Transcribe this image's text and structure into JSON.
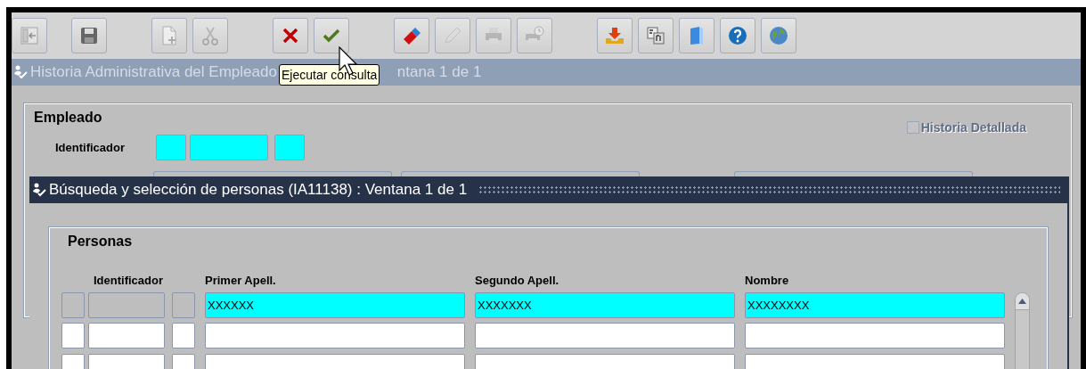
{
  "toolbar": {
    "groups": [
      [
        {
          "kind": "exit",
          "disabled": true
        }
      ],
      [
        {
          "kind": "save",
          "disabled": false
        }
      ],
      [
        {
          "kind": "new",
          "disabled": true
        },
        {
          "kind": "cut",
          "disabled": true
        }
      ],
      [
        {
          "kind": "cancel",
          "disabled": false
        },
        {
          "kind": "accept",
          "disabled": false
        }
      ],
      [
        {
          "kind": "eraser",
          "disabled": false
        },
        {
          "kind": "edit",
          "disabled": true
        },
        {
          "kind": "print",
          "disabled": true
        },
        {
          "kind": "print_schedule",
          "disabled": true
        }
      ],
      [
        {
          "kind": "download",
          "disabled": false
        },
        {
          "kind": "fields",
          "disabled": false
        },
        {
          "kind": "book",
          "disabled": false
        },
        {
          "kind": "help",
          "disabled": false
        },
        {
          "kind": "globe",
          "disabled": false
        }
      ]
    ]
  },
  "tooltip": "Ejecutar consulta",
  "window": {
    "title": "Historia Administrativa del Empleado",
    "title_end": "ntana 1 de 1"
  },
  "form": {
    "query_mode": true,
    "section": "Empleado",
    "identifier_label": "Identificador",
    "checkbox": {
      "label": "Historia Detallada",
      "checked": false,
      "disabled": true
    }
  },
  "dialog": {
    "title": "Búsqueda y selección de personas (IA11138) : Ventana 1 de 1",
    "section": "Personas",
    "columns": [
      "Identificador",
      "Primer Apell.",
      "Segundo Apell.",
      "Nombre"
    ],
    "rows": [
      {
        "selected": true,
        "primer_apellido": "XXXXXX",
        "segundo_apellido": "XXXXXXX",
        "nombre": "XXXXXXXX"
      },
      {
        "selected": false
      },
      {
        "selected": false
      }
    ]
  }
}
